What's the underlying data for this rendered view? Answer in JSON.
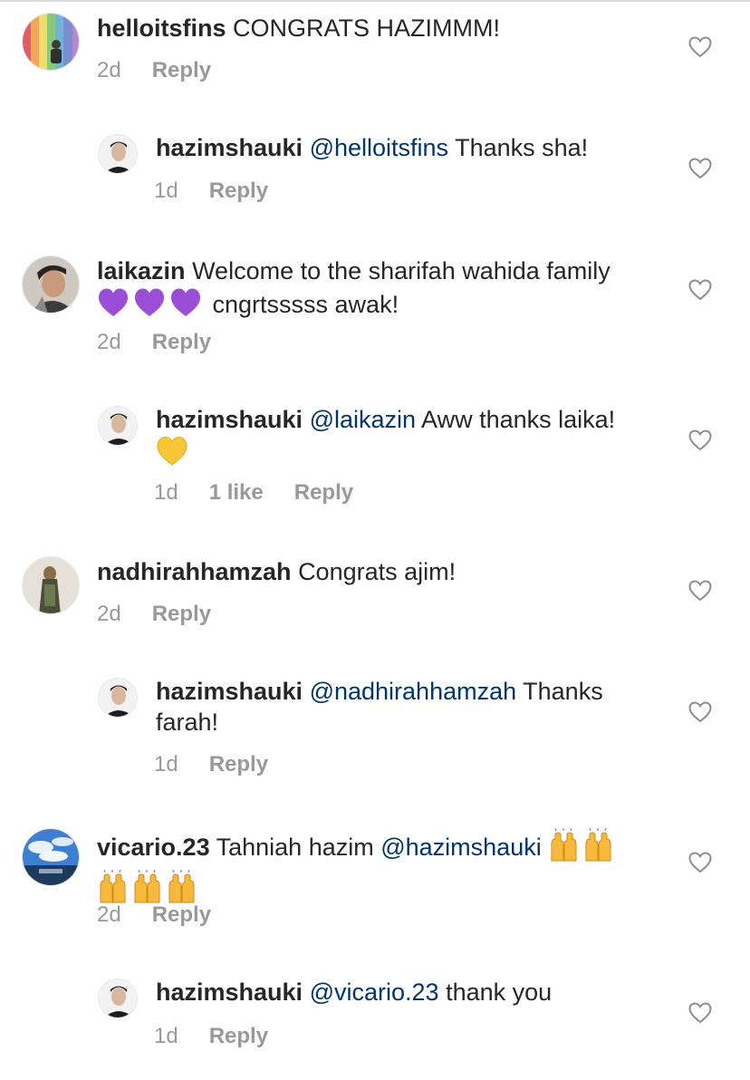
{
  "colors": {
    "mention": "#003569",
    "meta": "#999999",
    "text": "#262626",
    "heart_purple": "#9a4ed6",
    "heart_yellow": "#f8c737",
    "hands": "#f6b93b"
  },
  "comments": [
    {
      "username": "helloitsfins",
      "text": "CONGRATS HAZIMMM!",
      "time": "2d",
      "reply_label": "Reply",
      "avatar": "rainbow-wall-avatar",
      "replies": [
        {
          "username": "hazimshauki",
          "mention": "@helloitsfins",
          "text": "Thanks sha!",
          "time": "1d",
          "reply_label": "Reply"
        }
      ]
    },
    {
      "username": "laikazin",
      "text": "Welcome to the sharifah wahida family",
      "emoji": "purple-heart x3",
      "text_after": "cngrtsssss awak!",
      "time": "2d",
      "reply_label": "Reply",
      "replies": [
        {
          "username": "hazimshauki",
          "mention": "@laikazin",
          "text": "Aww thanks laika!",
          "emoji": "yellow-heart",
          "time": "1d",
          "likes": "1 like",
          "reply_label": "Reply"
        }
      ]
    },
    {
      "username": "nadhirahhamzah",
      "text": "Congrats ajim!",
      "time": "2d",
      "reply_label": "Reply",
      "replies": [
        {
          "username": "hazimshauki",
          "mention": "@nadhirahhamzah",
          "text": "Thanks",
          "text_line2": "farah!",
          "time": "1d",
          "reply_label": "Reply"
        }
      ]
    },
    {
      "username": "vicario.23",
      "text": "Tahniah hazim",
      "mention": "@hazimshauki",
      "emoji": "raising-hands x5",
      "time": "2d",
      "reply_label": "Reply",
      "replies": [
        {
          "username": "hazimshauki",
          "mention": "@vicario.23",
          "text": "thank you",
          "time": "1d",
          "reply_label": "Reply"
        }
      ]
    }
  ]
}
